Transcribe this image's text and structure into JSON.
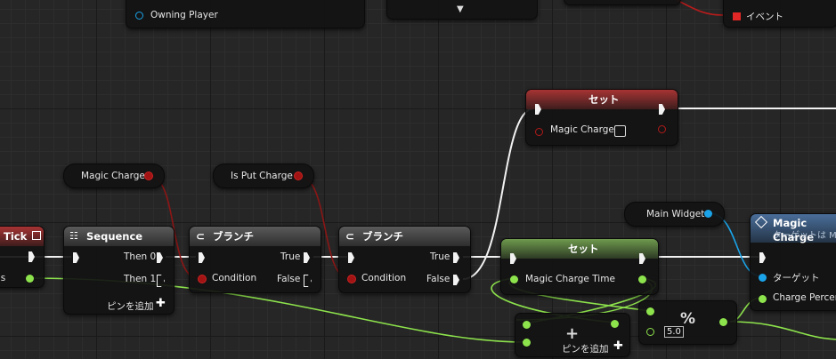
{
  "nodes": {
    "top_left": {
      "pin_label": "Owning Player"
    },
    "top_right": {
      "pin_label": "イベント"
    },
    "tick": {
      "title": "Tick",
      "pin_label": "onds"
    },
    "sequence": {
      "title": "Sequence",
      "then0": "Then 0",
      "then1": "Then 1",
      "add_pin": "ピンを追加"
    },
    "branch1": {
      "title": "ブランチ",
      "condition": "Condition",
      "true_label": "True",
      "false_label": "False"
    },
    "branch2": {
      "title": "ブランチ",
      "condition": "Condition",
      "true_label": "True",
      "false_label": "False"
    },
    "var_magic_charge": {
      "label": "Magic Charge"
    },
    "var_is_put_charge": {
      "label": "Is Put Charge"
    },
    "set_magic_charge": {
      "title": "セット",
      "pin_label": "Magic Charge"
    },
    "set_magic_charge_time": {
      "title": "セット",
      "pin_label": "Magic Charge Time"
    },
    "var_main_widget": {
      "label": "Main Widget"
    },
    "add_node": {
      "symbol": "+",
      "add_pin": "ピンを追加"
    },
    "percent_node": {
      "symbol": "%",
      "value": "5.0"
    },
    "magic_charge_func": {
      "title": "Magic Charge",
      "subtitle": "ターゲットは Ma",
      "target": "ターゲット",
      "charge_percent": "Charge Percent"
    }
  },
  "colors": {
    "exec": "#ffffff",
    "bool": "#a21414",
    "float": "#8de34c",
    "object": "#1aa3e8"
  }
}
